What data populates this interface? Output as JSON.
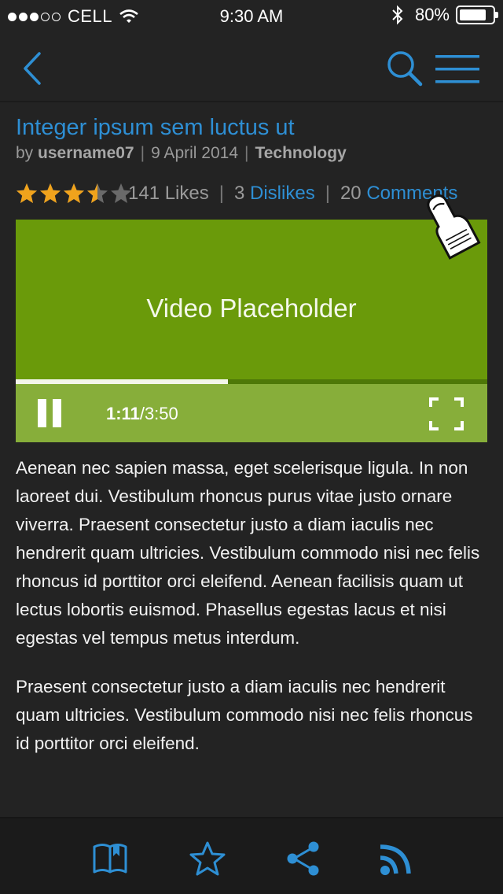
{
  "status_bar": {
    "carrier": "CELL",
    "time": "9:30 AM",
    "battery": "80%",
    "battery_level": 0.8,
    "signal_bars": 3,
    "signal_max": 5
  },
  "nav": {
    "back_icon": "chevron-left-icon",
    "search_icon": "search-icon",
    "menu_icon": "hamburger-menu-icon"
  },
  "article": {
    "title": "Integer ipsum sem luctus ut",
    "by": "by",
    "author": "username07",
    "date": "9 April 2014",
    "category": "Technology",
    "rating": 3.5,
    "rating_max": 5,
    "likes": "141 Likes",
    "dislikes_count": "3",
    "dislikes_label": "Dislikes",
    "comments_count": "20",
    "comments_label": "Comments"
  },
  "video": {
    "placeholder": "Video Placeholder",
    "elapsed": "1:11",
    "duration": "/3:50",
    "progress": 0.45,
    "pause_icon": "pause-icon",
    "fullscreen_icon": "fullscreen-icon"
  },
  "body": {
    "paragraphs": [
      "Aenean nec sapien massa, eget scelerisque ligula. In non laoreet dui. Vestibulum rhoncus purus vitae justo ornare viverra. Praesent consectetur justo a diam iaculis nec hendrerit quam ultricies. Vestibulum commodo nisi nec felis rhoncus id porttitor orci eleifend. Aenean facilisis quam ut lectus lobortis euismod. Phasellus egestas lacus et nisi egestas vel tempus metus interdum.",
      "Praesent consectetur justo a diam iaculis nec hendrerit quam ultricies. Vestibulum commodo nisi nec felis rhoncus id porttitor orci eleifend."
    ]
  },
  "tabbar": {
    "items": [
      "book-icon",
      "star-icon",
      "share-icon",
      "rss-icon"
    ]
  },
  "colors": {
    "accent": "#2e8fd4",
    "background": "#232323",
    "video_green": "#6a9a0a",
    "controls_green": "#87ae3a",
    "star_orange": "#f0a31c"
  }
}
